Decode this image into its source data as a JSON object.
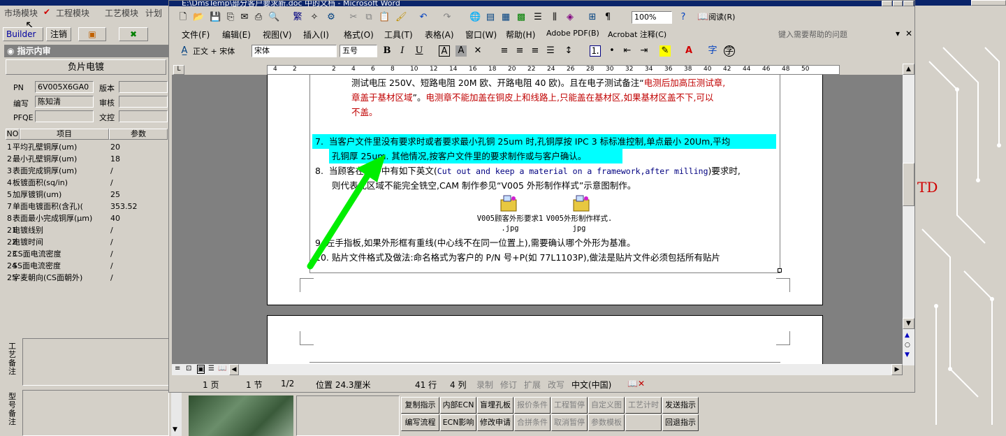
{
  "app": {
    "menu": [
      "市场模块",
      "工程模块",
      "工艺模块",
      "计划"
    ],
    "toolbar": {
      "builder": "Builder",
      "logout": "注销"
    },
    "panel_title": "指示内审",
    "product_title": "负片电镀",
    "fields": {
      "pn_label": "PN",
      "pn_value": "6V005X6GA0",
      "version_label": "版本",
      "version_value": "",
      "author_label": "编写",
      "author_value": "陈知清",
      "review_label": "审核",
      "review_value": "",
      "pfqe_label": "PFQE",
      "pfqe_value": "",
      "doc_label": "文控",
      "doc_value": ""
    },
    "table": {
      "headers": [
        "NO",
        "项目",
        "参数"
      ],
      "rows": [
        [
          "1",
          "平均孔壁铜厚(um)",
          "20"
        ],
        [
          "2",
          "最小孔壁铜厚(um)",
          "18"
        ],
        [
          "3",
          "表面完成铜厚(um)",
          "/"
        ],
        [
          "4",
          "板镀面积(sq/in)",
          "/"
        ],
        [
          "5",
          "加厚镀铜(um)",
          "25"
        ],
        [
          "7",
          "单面电镀面积(含孔)(",
          "353.52"
        ],
        [
          "8",
          "表面最小完成铜厚(μm)",
          "40"
        ],
        [
          "21",
          "电镀线别",
          "/"
        ],
        [
          "22",
          "电镀时间",
          "/"
        ],
        [
          "23",
          "CS面电流密度",
          "/"
        ],
        [
          "24",
          "SS面电流密度",
          "/"
        ],
        [
          "25",
          "字麦朝向(CS面朝外)",
          "/"
        ]
      ]
    },
    "notes": {
      "process_label": "工艺备注",
      "model_label": "型号备注"
    },
    "buttons": [
      [
        "复制指示",
        "内部ECN",
        "盲埋孔板",
        "报价条件",
        "工程暂停",
        "自定义图",
        "工艺计时",
        "发送指示"
      ],
      [
        "编写流程",
        "ECN影响",
        "修改申请",
        "合拼条件",
        "取消暂停",
        "参数模板",
        "",
        "回退指示"
      ]
    ],
    "disabled_buttons": [
      "报价条件",
      "工程暂停",
      "自定义图",
      "工艺计时",
      "合拼条件",
      "取消暂停",
      "参数模板"
    ],
    "right_text": "TD"
  },
  "word": {
    "title": "E:\\DmsTemp\\部分客户要求新.doc 中的文档 - Microsoft Word",
    "menu": [
      "文件(F)",
      "编辑(E)",
      "视图(V)",
      "插入(I)",
      "格式(O)",
      "工具(T)",
      "表格(A)",
      "窗口(W)",
      "帮助(H)",
      "Adobe PDF(B)",
      "Acrobat 注释(C)"
    ],
    "help_placeholder": "键入需要帮助的问题",
    "zoom": "100%",
    "read_button": "阅读(R)",
    "style": "正文 + 宋体",
    "font": "宋体",
    "size": "五号",
    "ruler_ticks": [
      "4",
      "2",
      "",
      "2",
      "4",
      "6",
      "8",
      "10",
      "12",
      "14",
      "16",
      "18",
      "20",
      "22",
      "24",
      "26",
      "28",
      "30",
      "32",
      "34",
      "36",
      "38",
      "40",
      "42",
      "44",
      "46",
      "48",
      "50"
    ],
    "vruler_ticks": [
      "36",
      "38",
      "40",
      "42",
      "44",
      "46",
      "48",
      "50"
    ],
    "doc": {
      "p6_line1": "测试电压 250V、短路电阻 20M 欧、开路电阻 40 欧)。且在电子测试备注“",
      "p6_line1_red": "电测后加高压测试章,",
      "p6_line2_red_a": "章盖于基材区域",
      "p6_line2_mid": "”。",
      "p6_line2_red_b": "电测章不能加盖在铜皮上和线路上,只能盖在基材区,如果基材区盖不下,可以",
      "p6_line3_red": "不盖。",
      "p7_num": "7.",
      "p7_line1": "当客户文件里没有要求时或者要求最小孔铜 25um 时,孔铜厚按 IPC 3 标标准控制,单点最小 20Um,平均",
      "p7_line2": "孔铜厚 25um. 其他情况,按客户文件里的要求制作或与客户确认。",
      "p8_num": "8.",
      "p8_line1a": "当顾客在文件中有如下英文(",
      "p8_line1_en": "Cut out and keep a material on a framework,after milling",
      "p8_line1b": ")要求时,",
      "p8_line2": "则代表此区域不能完全铣空,CAM 制作参见“V005 外形制作样式”示意图制作。",
      "obj1": "V005顾客外形要求1",
      "obj1_ext": ".jpg",
      "obj2": "V005外形制作样式.",
      "obj2_ext": "jpg",
      "p9": "9. 左手指板,如果外形框有重线(中心线不在同一位置上),需要确认哪个外形为基准。",
      "p10": "10. 贴片文件格式及做法:命名格式为客户的 P/N 号+P(如 77L1103P),做法是贴片文件必须包括所有贴片"
    },
    "status": {
      "page": "1 页",
      "section": "1 节",
      "pages": "1/2",
      "position": "位置 24.3厘米",
      "line": "41 行",
      "col": "4 列",
      "rec": "录制",
      "trk": "修订",
      "ext": "扩展",
      "ovr": "改写",
      "lang": "中文(中国)"
    },
    "colors": {
      "highlight": "#00ffff",
      "red_text": "#c00000",
      "arrow": "#00ee00",
      "title_bar": "#0a246a"
    }
  }
}
